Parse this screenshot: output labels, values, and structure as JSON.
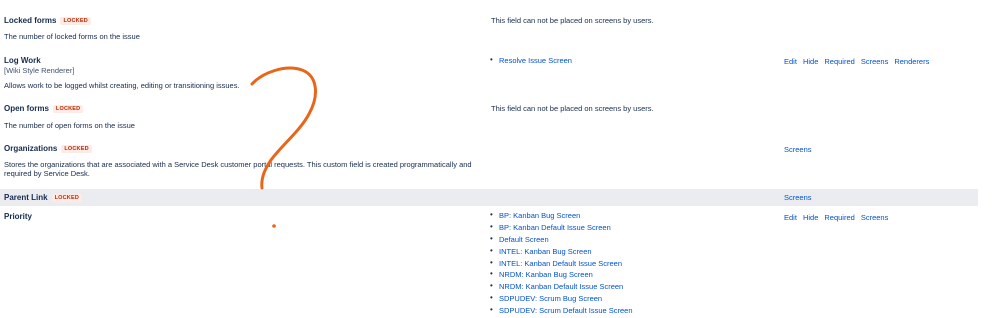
{
  "fields": [
    {
      "name": "Locked forms",
      "badge": "LOCKED",
      "description": "The number of locked forms on the issue",
      "note": "This field can not be placed on screens by users."
    },
    {
      "name": "Log Work",
      "renderer": "[Wiki Style Renderer]",
      "description": "Allows work to be logged whilst creating, editing or transitioning issues.",
      "screens": [
        "Resolve Issue Screen"
      ],
      "actions": [
        "Edit",
        "Hide",
        "Required",
        "Screens",
        "Renderers"
      ]
    },
    {
      "name": "Open forms",
      "badge": "LOCKED",
      "description": "The number of open forms on the issue",
      "note": "This field can not be placed on screens by users."
    },
    {
      "name": "Organizations",
      "badge": "LOCKED",
      "description": "Stores the organizations that are associated with a Service Desk customer portal requests. This custom field is created programmatically and required by Service Desk.",
      "actions": [
        "Screens"
      ]
    },
    {
      "name": "Parent Link",
      "badge": "LOCKED",
      "actions": [
        "Screens"
      ]
    },
    {
      "name": "Priority",
      "screens": [
        "BP: Kanban Bug Screen",
        "BP: Kanban Default Issue Screen",
        "Default Screen",
        "INTEL: Kanban Bug Screen",
        "INTEL: Kanban Default Issue Screen",
        "NRDM: Kanban Bug Screen",
        "NRDM: Kanban Default Issue Screen",
        "SDPUDEV: Scrum Bug Screen",
        "SDPUDEV: Scrum Default Issue Screen"
      ],
      "actions": [
        "Edit",
        "Hide",
        "Required",
        "Screens"
      ]
    }
  ],
  "annotation": {
    "color": "#e8651a",
    "shape": "question-mark"
  }
}
